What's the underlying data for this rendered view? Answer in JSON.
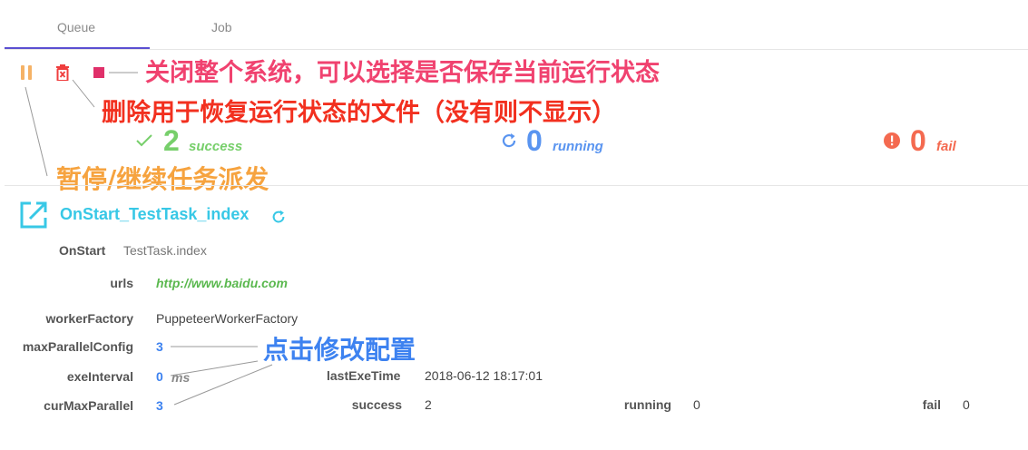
{
  "tabs": [
    {
      "label": "Queue",
      "active": true
    },
    {
      "label": "Job",
      "active": false
    }
  ],
  "toolbar": {
    "pause_icon": "pause-icon",
    "delete_icon": "trash-icon",
    "stop_icon": "stop-icon"
  },
  "annotations": {
    "stop": "关闭整个系统，可以选择是否保存当前运行状态",
    "delete": "删除用于恢复运行状态的文件（没有则不显示）",
    "pause": "暂停/继续任务派发",
    "config": "点击修改配置"
  },
  "stats": {
    "success": {
      "count": "2",
      "label": "success"
    },
    "running": {
      "count": "0",
      "label": "running"
    },
    "fail": {
      "count": "0",
      "label": "fail"
    }
  },
  "task": {
    "title": "OnStart_TestTask_index",
    "on_start_label": "OnStart",
    "on_start_value": "TestTask.index",
    "urls_label": "urls",
    "urls_value": "http://www.baidu.com",
    "worker_factory_label": "workerFactory",
    "worker_factory_value": "PuppeteerWorkerFactory",
    "max_parallel_label": "maxParallelConfig",
    "max_parallel_value": "3",
    "exe_interval_label": "exeInterval",
    "exe_interval_value": "0",
    "exe_interval_unit": "ms",
    "last_exe_label": "lastExeTime",
    "last_exe_value": "2018-06-12 18:17:01",
    "cur_max_parallel_label": "curMaxParallel",
    "cur_max_parallel_value": "3",
    "success_label": "success",
    "success_value": "2",
    "running_label": "running",
    "running_value": "0",
    "fail_label": "fail",
    "fail_value": "0"
  },
  "colors": {
    "accent": "#5b4fd1",
    "success": "#77cf6b",
    "running": "#5994f0",
    "fail": "#f46a50",
    "task_title": "#38c8e6"
  }
}
